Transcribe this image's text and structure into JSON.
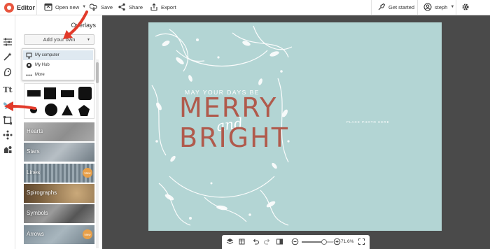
{
  "topbar": {
    "app_title": "Editor",
    "open_new": "Open new",
    "save": "Save",
    "share": "Share",
    "export": "Export",
    "get_started": "Get started",
    "user": "steph",
    "icons": [
      "picmonkey-logo-icon",
      "open-new-icon",
      "save-icon",
      "share-icon",
      "export-icon",
      "get-started-icon",
      "user-icon",
      "settings-icon"
    ]
  },
  "rail": {
    "items": [
      "edits-icon",
      "effects-icon",
      "touch-up-icon",
      "text-icon",
      "overlays-icon",
      "frames-icon",
      "textures-icon",
      "themes-icon"
    ],
    "text_glyph": "Tt",
    "active_item": "overlays-icon"
  },
  "panel": {
    "title": "Overlays",
    "add_button": "Add your own",
    "dropdown": [
      {
        "label": "My computer",
        "icon": "computer-icon",
        "active": true
      },
      {
        "label": "My Hub",
        "icon": "hub-icon",
        "active": false
      },
      {
        "label": "More",
        "icon": "more-icon",
        "active": false
      }
    ],
    "categories": [
      {
        "label": "Hearts",
        "badge": ""
      },
      {
        "label": "Stars",
        "badge": ""
      },
      {
        "label": "Lines",
        "badge": "New"
      },
      {
        "label": "Spirographs",
        "badge": ""
      },
      {
        "label": "Symbols",
        "badge": ""
      },
      {
        "label": "Arrows",
        "badge": "New"
      }
    ]
  },
  "canvas": {
    "line1": "MAY YOUR DAYS BE",
    "merry": "MERRY",
    "and": "and",
    "bright": "BRIGHT",
    "photo_placeholder": "PLACE PHOTO HERE",
    "background_color": "#b3d5d4",
    "accent_color": "#b05a4c"
  },
  "bottombar": {
    "zoom_value": "71.6%",
    "zoom_level": 0.716,
    "icons": [
      "layers-icon",
      "crop-icon",
      "undo-icon",
      "redo-icon",
      "compare-icon",
      "zoom-out-icon",
      "zoom-in-icon",
      "fullscreen-icon"
    ]
  },
  "colors": {
    "workspace": "#4a4a4a",
    "arrow_red": "#e23a2a",
    "brand": "#e8553e"
  }
}
